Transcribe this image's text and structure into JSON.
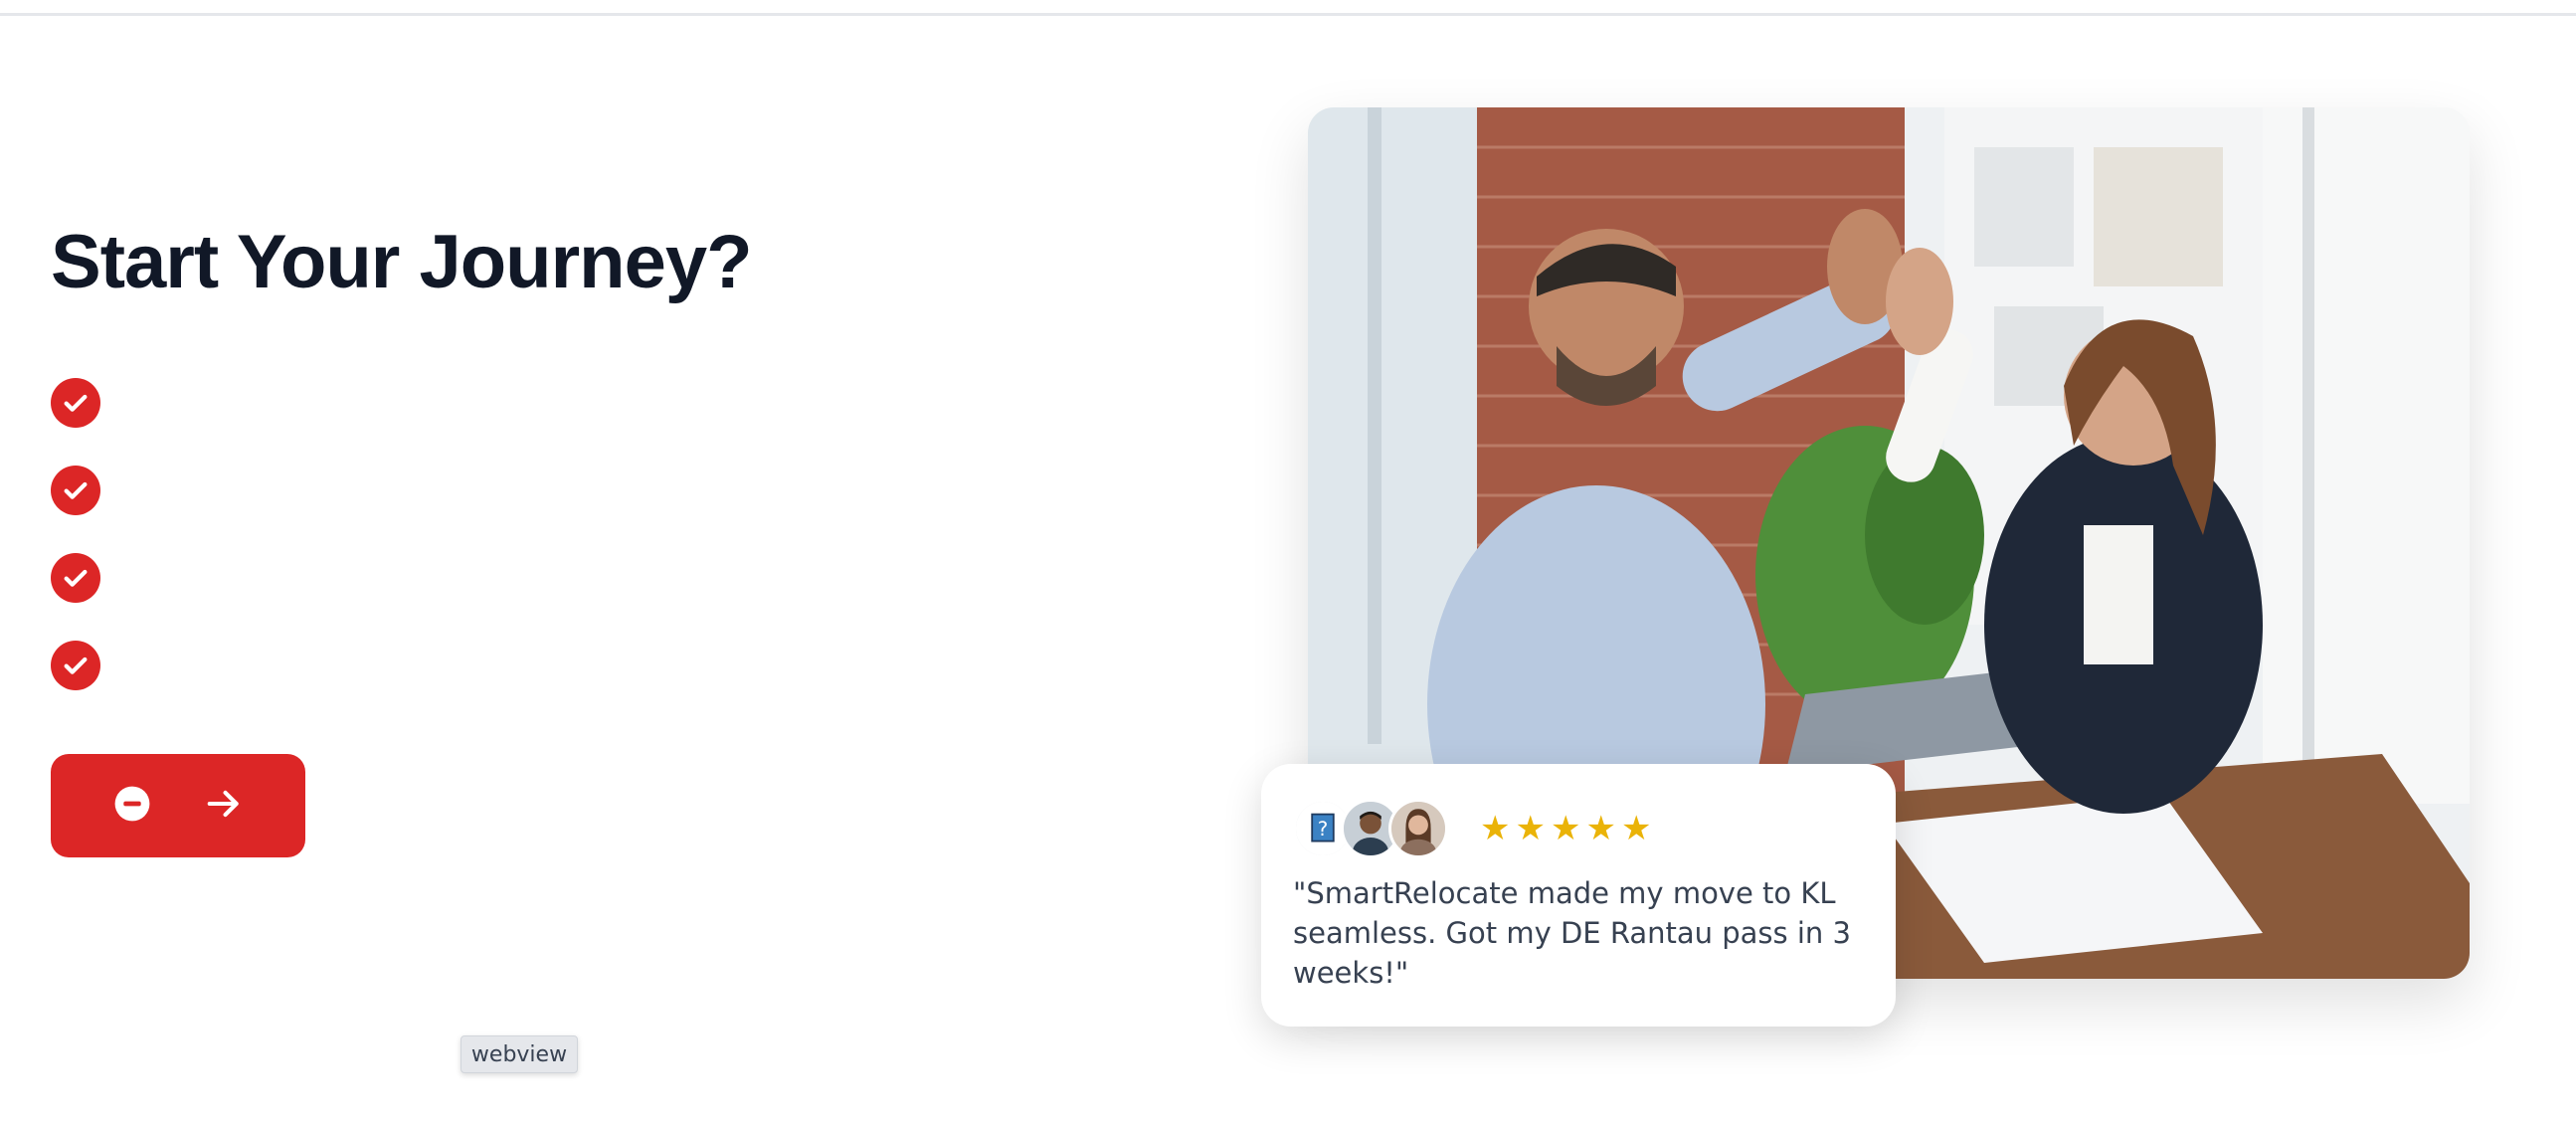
{
  "hero": {
    "title": "Start Your Journey?",
    "checklist": [
      {
        "icon": "check-circle-icon"
      },
      {
        "icon": "check-circle-icon"
      },
      {
        "icon": "check-circle-icon"
      },
      {
        "icon": "check-circle-icon"
      }
    ],
    "cta": {
      "icons": [
        "minus-circle-icon",
        "arrow-right-icon"
      ]
    }
  },
  "photo": {
    "alt_icon": "team-high-five-photo"
  },
  "review": {
    "avatars": [
      "broken-image-icon",
      "avatar-man",
      "avatar-woman"
    ],
    "rating": 5,
    "quote": "\"SmartRelocate made my move to KL seamless. Got my DE Rantau pass in 3 weeks!\""
  },
  "webview_label": "webview",
  "colors": {
    "accent": "#dc2626",
    "heading": "#111827",
    "star": "#eab308"
  }
}
